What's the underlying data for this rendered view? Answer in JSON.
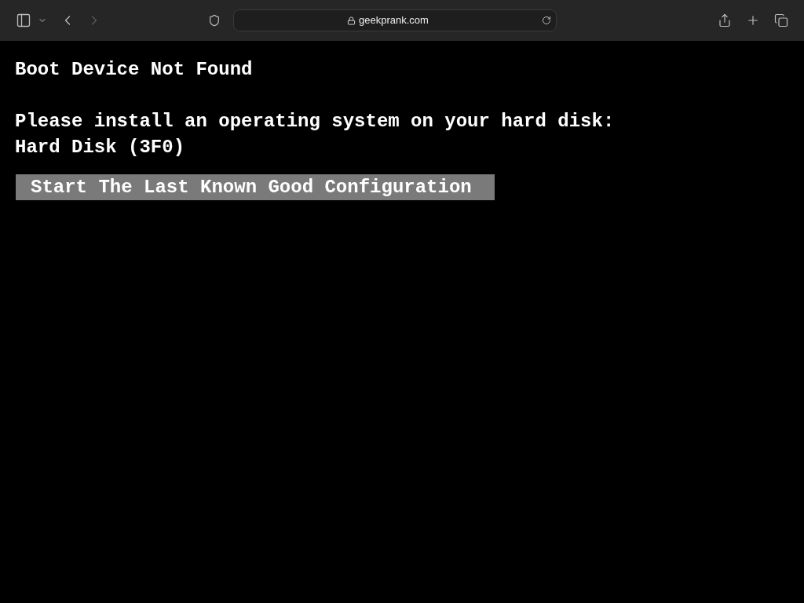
{
  "toolbar": {
    "url": "geekprank.com",
    "back_disabled": false,
    "forward_disabled": true
  },
  "screen": {
    "title": "Boot Device Not Found",
    "lines": [
      "Please install an operating system on your hard disk:",
      "Hard Disk (3F0)"
    ],
    "option": {
      "label": "Start The Last Known Good Configuration",
      "selected": true
    }
  }
}
